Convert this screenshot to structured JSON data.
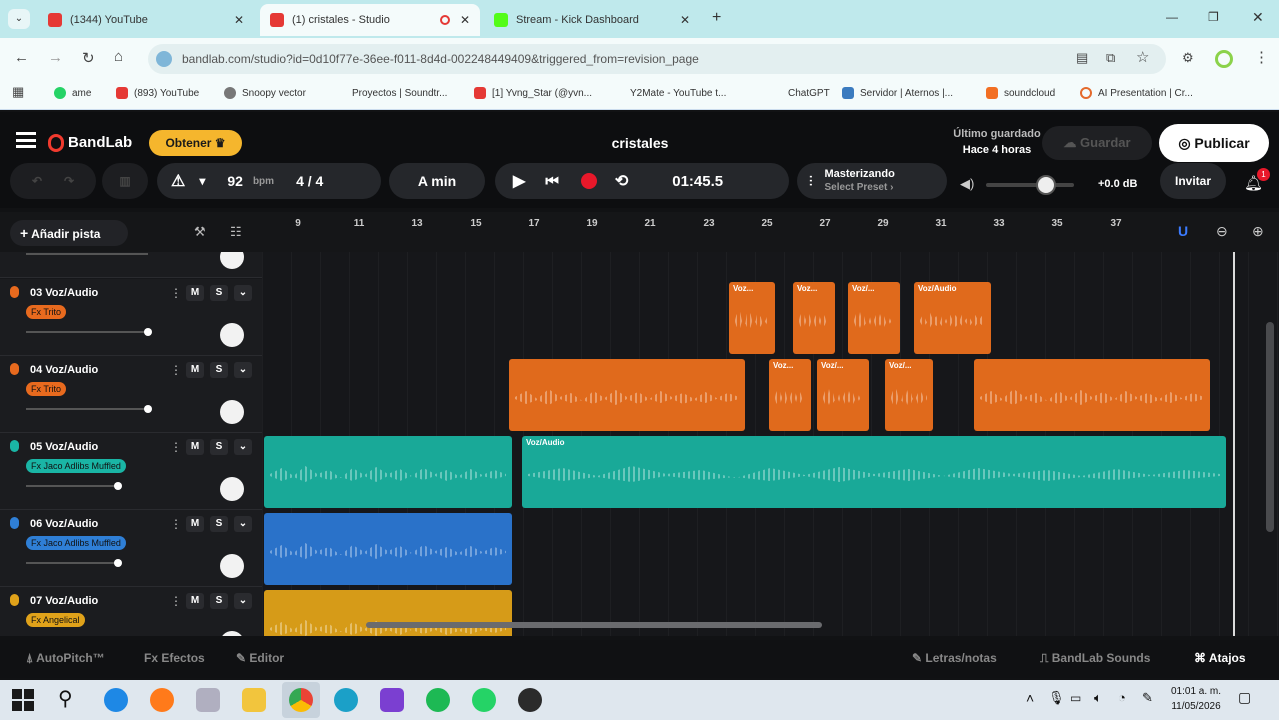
{
  "browser": {
    "tabs": [
      {
        "title": "(1344) YouTube",
        "color": "#e53935"
      },
      {
        "title": "(1) cristales - Studio",
        "color": "#e53935"
      },
      {
        "title": "Stream - Kick Dashboard",
        "color": "#53fc18"
      }
    ],
    "new_tab": "+",
    "url": "bandlab.com/studio?id=0d10f77e-36ee-f011-8d4d-002248449409&triggered_from=revision_page",
    "bookmarks": [
      "ame",
      "(893) YouTube",
      "Snoopy vector",
      "Proyectos | Soundtr...",
      "[1] Yvng_Star (@yvn...",
      "Y2Mate - YouTube t...",
      "ChatGPT",
      "Servidor | Aternos |...",
      "soundcloud",
      "AI Presentation | Cr..."
    ]
  },
  "app": {
    "logo": "BandLab",
    "get_button": "Obtener",
    "project_title": "cristales",
    "saved_label": "Último guardado",
    "saved_time": "Hace 4 horas",
    "save_button": "Guardar",
    "publish_button": "Publicar",
    "bpm": "92",
    "bpm_unit": "bpm",
    "time_signature": "4 / 4",
    "key": "A min",
    "time": "01:45.5",
    "mastering_title": "Masterizando",
    "mastering_sub": "Select Preset ›",
    "volume_db": "+0.0 dB",
    "invite_button": "Invitar",
    "notif_count": "1",
    "add_track": "Añadir pista",
    "ruler_marks": [
      "9",
      "11",
      "13",
      "15",
      "17",
      "19",
      "21",
      "23",
      "25",
      "27",
      "29",
      "31",
      "33",
      "35",
      "37"
    ],
    "tracks": [
      {
        "name": "03 Voz/Audio",
        "fx": "Fx Trito",
        "color": "#e86a1e",
        "fxcolor": "#e86a1e"
      },
      {
        "name": "04 Voz/Audio",
        "fx": "Fx Trito",
        "color": "#e86a1e",
        "fxcolor": "#e86a1e"
      },
      {
        "name": "05 Voz/Audio",
        "fx": "Fx Jaco Adlibs Muffled",
        "color": "#1ab5a5",
        "fxcolor": "#1ab5a5"
      },
      {
        "name": "06 Voz/Audio",
        "fx": "Fx Jaco Adlibs Muffled",
        "color": "#2f7fd6",
        "fxcolor": "#2f7fd6"
      },
      {
        "name": "07 Voz/Audio",
        "fx": "Fx Angelical",
        "color": "#e0a21a",
        "fxcolor": "#e0a21a"
      }
    ],
    "clip_labels": {
      "t3": [
        "Voz...",
        "Voz...",
        "Voz/...",
        "Voz/Audio"
      ],
      "t4": [
        "Voz...",
        "Voz/...",
        "Voz/..."
      ],
      "t5": "Voz/Audio"
    },
    "footer": {
      "autopitch": "AutoPitch™",
      "effects": "Efectos",
      "editor": "Editor",
      "lyrics": "Letras/notas",
      "sounds": "BandLab Sounds",
      "shortcuts": "Atajos"
    }
  },
  "taskbar": {
    "time": "01:01 a. m.",
    "date": "11/05/2026"
  }
}
